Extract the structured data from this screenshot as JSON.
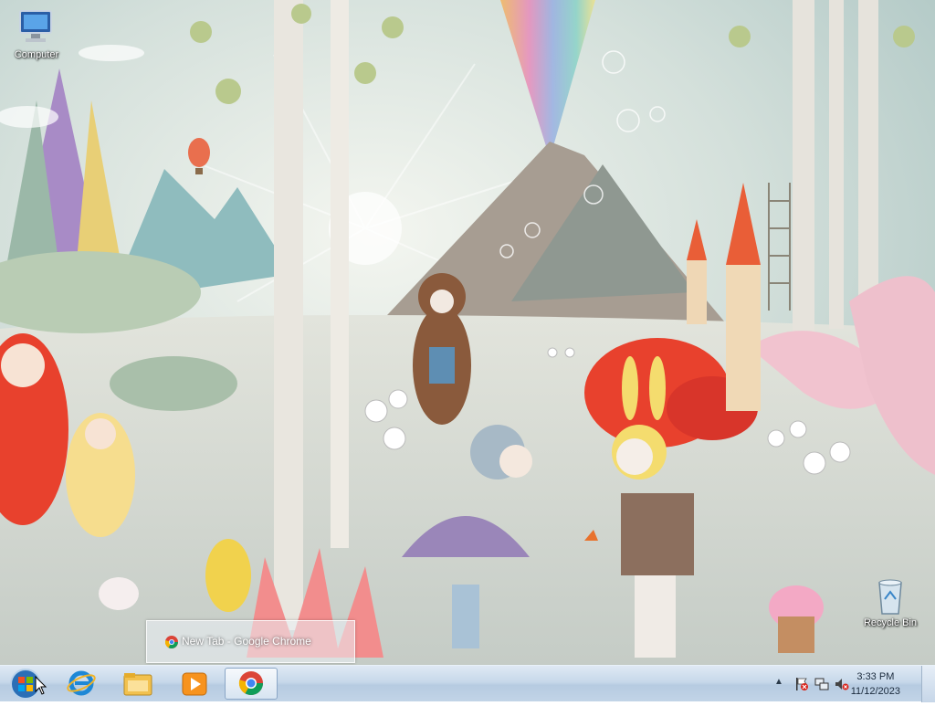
{
  "desktop": {
    "icons": [
      {
        "label": "Computer",
        "icon": "computer-icon"
      },
      {
        "label": "Recycle Bin",
        "icon": "recycle-bin-icon"
      }
    ]
  },
  "preview": {
    "title": "New Tab - Google Chrome",
    "icon": "chrome-icon"
  },
  "taskbar": {
    "start": {
      "icon": "windows-start-orb-icon"
    },
    "pinned": [
      {
        "name": "Internet Explorer",
        "icon": "internet-explorer-icon"
      },
      {
        "name": "Windows Explorer",
        "icon": "file-explorer-icon"
      },
      {
        "name": "Windows Media Player",
        "icon": "media-player-icon"
      },
      {
        "name": "Google Chrome",
        "icon": "chrome-icon",
        "active": true
      }
    ],
    "tray": {
      "icons": [
        "show-hidden-icons-icon",
        "action-center-flag-icon",
        "network-icon",
        "volume-muted-icon"
      ],
      "time": "3:33 PM",
      "date": "11/12/2023"
    }
  },
  "colors": {
    "sky": "#c9d9d6",
    "accent_red": "#e8412d",
    "accent_pink": "#f2b8c6",
    "taskbar": "#c7d8ea"
  }
}
